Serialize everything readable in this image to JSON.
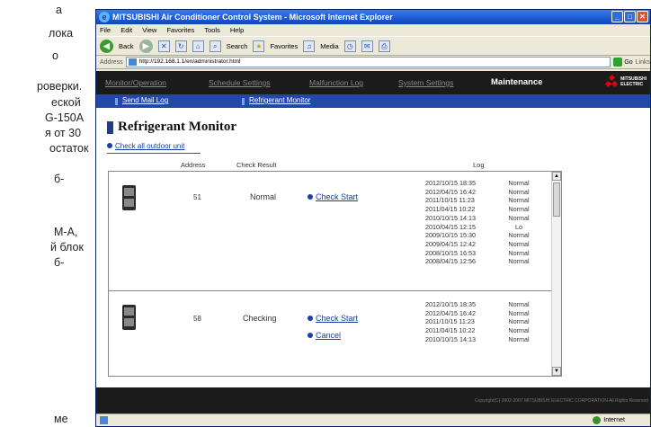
{
  "doc_fragment": [
    "а",
    "лока",
    "о",
    "роверки.",
    "еской",
    "G-150A",
    "я от 30",
    "остаток",
    "б-",
    "M-A,",
    "й блок",
    "б-",
    "ме"
  ],
  "window": {
    "title": "MITSUBISHI Air Conditioner Control System - Microsoft Internet Explorer",
    "menu": [
      "File",
      "Edit",
      "View",
      "Favorites",
      "Tools",
      "Help"
    ],
    "toolbar": {
      "back": "Back",
      "search": "Search",
      "favorites": "Favorites",
      "media": "Media"
    },
    "address_label": "Address",
    "address_value": "http://192.168.1.1/en/administrator.html",
    "go": "Go",
    "links": "Links"
  },
  "nav": {
    "items": [
      "Monitor/Operation",
      "Schedule Settings",
      "Malfunction Log",
      "System Settings",
      "Maintenance"
    ],
    "active": "Maintenance",
    "logo_text": [
      "MITSUBISHI",
      "ELECTRIC"
    ]
  },
  "subnav": [
    "Send Mail Log",
    "Refrigerant Monitor"
  ],
  "page_title": "Refrigerant Monitor",
  "check_all_link": "Check all outdoor unit",
  "table": {
    "headers": {
      "address": "Address",
      "check_result": "Check Result",
      "log": "Log"
    },
    "rows": [
      {
        "address": "51",
        "result": "Normal",
        "actions": [
          "Check Start"
        ],
        "log": [
          [
            "2012/10/15  18:35",
            "Normal"
          ],
          [
            "2012/04/15  16:42",
            "Normal"
          ],
          [
            "2011/10/15  11:23",
            "Normal"
          ],
          [
            "2011/04/15  10:22",
            "Normal"
          ],
          [
            "2010/10/15  14:13",
            "Normal"
          ],
          [
            "2010/04/15  12:15",
            "Lo"
          ],
          [
            "2009/10/15  15:30",
            "Normal"
          ],
          [
            "2009/04/15  12:42",
            "Normal"
          ],
          [
            "2008/10/15  16:53",
            "Normal"
          ],
          [
            "2008/04/15  12:56",
            "Normal"
          ]
        ]
      },
      {
        "address": "58",
        "result": "Checking",
        "actions": [
          "Check Start",
          "Cancel"
        ],
        "log": [
          [
            "2012/10/15  18:35",
            "Normal"
          ],
          [
            "2012/04/15  16:42",
            "Normal"
          ],
          [
            "2011/10/15  11:23",
            "Normal"
          ],
          [
            "2011/04/15  10:22",
            "Normal"
          ],
          [
            "2010/10/15  14:13",
            "Normal"
          ]
        ]
      }
    ]
  },
  "footer": "Copyright(C) 2002-2007 MITSUBISHI ELECTRIC CORPORATION All Rights Reserved",
  "status": {
    "zone": "Internet"
  },
  "colors": {
    "nav_bg": "#1b1b1b",
    "subnav_bg": "#2448a8",
    "link": "#1a3aa5",
    "brand_red": "#e60012"
  }
}
